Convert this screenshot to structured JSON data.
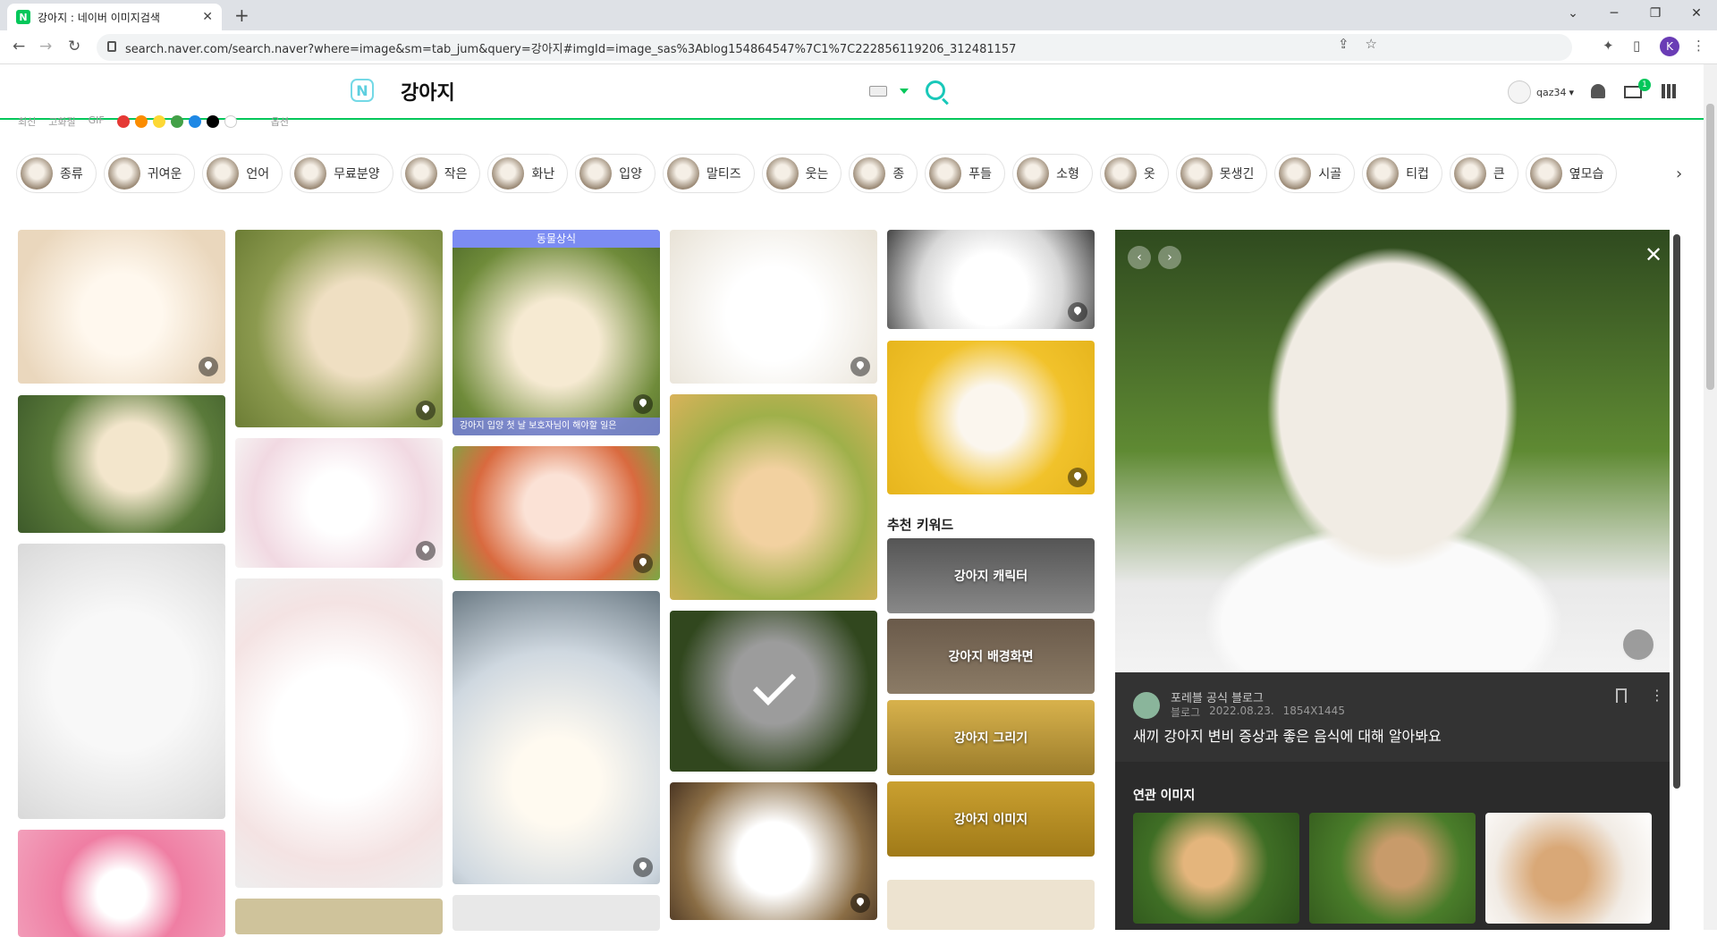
{
  "browser": {
    "tab_title": "강아지 : 네이버 이미지검색",
    "tab_favicon": "N",
    "url": "search.naver.com/search.naver?where=image&sm=tab_jum&query=강아지#imgId=image_sas%3Ablog154864547%7C1%7C222856119206_312481157",
    "profile_letter": "K"
  },
  "header": {
    "logo": "N",
    "query": "강아지",
    "username": "qaz34",
    "mail_count": "1"
  },
  "filters": {
    "items": [
      "최신",
      "고화질",
      "GIF"
    ],
    "colors": [
      "#e53935",
      "#fb8c00",
      "#fdd835",
      "#43a047",
      "#1e88e5",
      "#000000",
      "#ffffff"
    ],
    "extra": "옵션"
  },
  "chips": [
    "종류",
    "귀여운",
    "언어",
    "무료분양",
    "작은",
    "화난",
    "입양",
    "말티즈",
    "웃는",
    "종",
    "푸들",
    "소형",
    "옷",
    "못생긴",
    "시골",
    "티컵",
    "큰",
    "옆모습"
  ],
  "grid": {
    "banner_label": "동물상식",
    "banner_caption": "강아지 입양 첫 날 보호자님이 해야할 일은",
    "recommend_title": "추천 키워드",
    "recommend": [
      "강아지 캐릭터",
      "강아지 배경화면",
      "강아지 그리기",
      "강아지 이미지"
    ]
  },
  "viewer": {
    "source": "포레블 공식 블로그",
    "type": "블로그",
    "date": "2022.08.23.",
    "size": "1854X1445",
    "title": "새끼 강아지 변비 증상과 좋은 음식에 대해 알아봐요",
    "related_title": "연관 이미지"
  }
}
